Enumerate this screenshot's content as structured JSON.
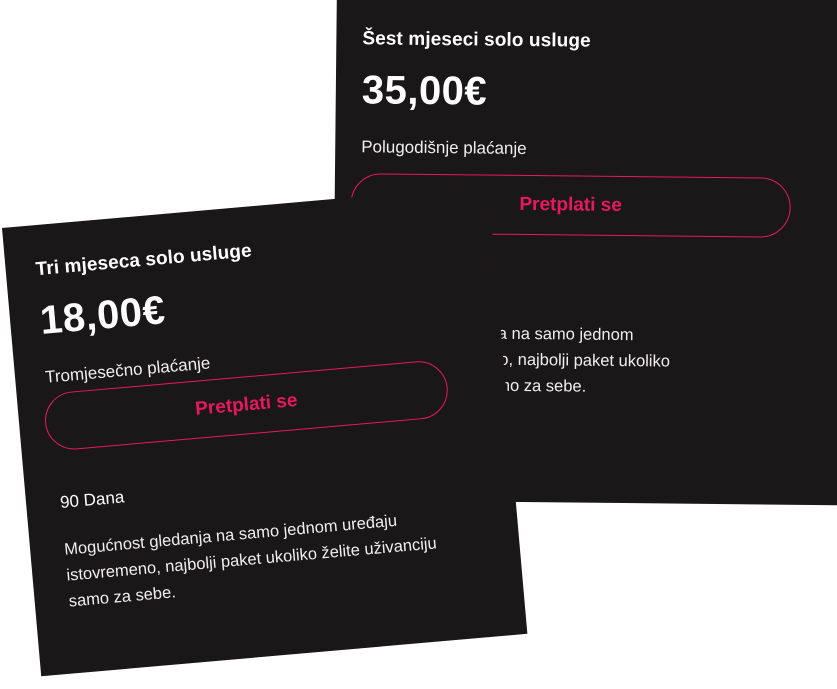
{
  "plans": [
    {
      "title": "Tri mjeseca solo usluge",
      "price": "18,00€",
      "period": "Tromjesečno plaćanje",
      "button_label": "Pretplati se",
      "duration": "90 Dana",
      "description": "Mogućnost gledanja na samo jednom uređaju istovremeno, najbolji paket ukoliko želite uživanciju samo za sebe."
    },
    {
      "title": "Šest mjeseci solo usluge",
      "price": "35,00€",
      "period": "Polugodišnje plaćanje",
      "button_label": "Pretplati se",
      "description": "Mogućnost gledanja na samo jednom uređaju istovremeno, najbolji paket ukoliko želite uživanciju samo za sebe."
    }
  ],
  "colors": {
    "card_background": "#1a1718",
    "accent": "#e8185f",
    "text": "#ffffff"
  }
}
